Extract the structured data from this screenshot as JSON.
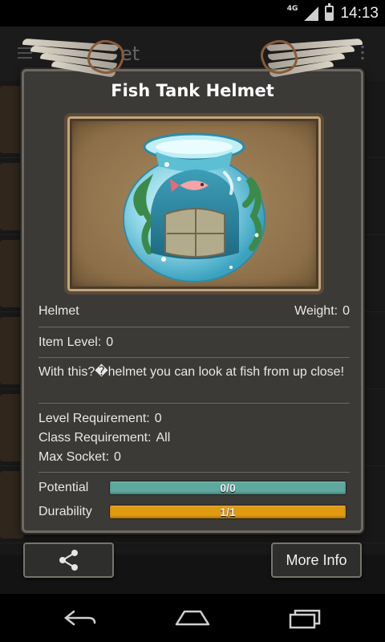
{
  "status_bar": {
    "network": "4G",
    "time": "14:13"
  },
  "background_app": {
    "title_partial": "et"
  },
  "dialog": {
    "title": "Fish Tank Helmet",
    "item_type": "Helmet",
    "weight_label": "Weight:",
    "weight_value": "0",
    "item_level_label": "Item Level:",
    "item_level_value": "0",
    "description": "With this?�helmet you can look at fish from up close!",
    "level_requirement_label": "Level Requirement:",
    "level_requirement_value": "0",
    "class_requirement_label": "Class Requirement:",
    "class_requirement_value": "All",
    "max_socket_label": "Max Socket:",
    "max_socket_value": "0",
    "potential": {
      "label": "Potential",
      "text": "0/0",
      "fraction": 1.0,
      "color": "#5fa89e"
    },
    "durability": {
      "label": "Durability",
      "text": "1/1",
      "fraction": 1.0,
      "color": "#e09a12"
    }
  },
  "buttons": {
    "share_icon": "share-icon",
    "more_info_label": "More Info"
  },
  "navbar": {
    "icons": [
      "back-icon",
      "home-icon",
      "recents-icon"
    ]
  }
}
